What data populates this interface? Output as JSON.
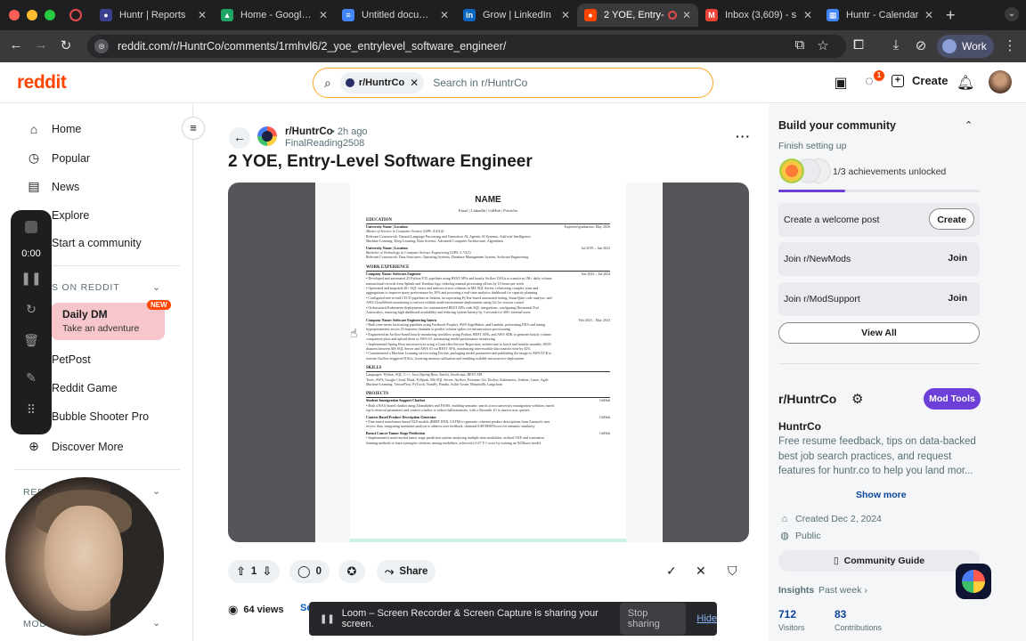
{
  "browser": {
    "tabs": [
      {
        "label": "Huntr | Reports",
        "favicon": "huntr-icon",
        "color": "#3b3f8f"
      },
      {
        "label": "Home - Google Drive",
        "favicon": "google-drive-icon",
        "color": "#1fa463"
      },
      {
        "label": "Untitled document",
        "favicon": "google-docs-icon",
        "color": "#4285f4"
      },
      {
        "label": "Grow | LinkedIn",
        "favicon": "linkedin-icon",
        "color": "#0a66c2"
      },
      {
        "label": "2 YOE, Entry-",
        "favicon": "reddit-icon",
        "color": "#ff4500"
      },
      {
        "label": "Inbox (3,609) - s",
        "favicon": "gmail-icon",
        "color": "#ea4335"
      },
      {
        "label": "Huntr - Calendar",
        "favicon": "calendar-icon",
        "color": "#4285f4"
      }
    ],
    "url": "reddit.com/r/HuntrCo/comments/1rmhvl6/2_yoe_entrylevel_software_engineer/",
    "profile_label": "Work"
  },
  "header": {
    "logo": "reddit",
    "search_chip": "r/HuntrCo",
    "search_placeholder": "Search in r/HuntrCo",
    "chat_badge": "1",
    "create_label": "Create"
  },
  "left_nav": {
    "items": [
      {
        "label": "Home",
        "icon": "home-icon"
      },
      {
        "label": "Popular",
        "icon": "popular-icon"
      },
      {
        "label": "News",
        "icon": "news-icon"
      },
      {
        "label": "Explore",
        "icon": "explore-icon"
      },
      {
        "label": "Start a community",
        "icon": "plus-icon"
      }
    ],
    "section_games": "S ON REDDIT",
    "daily_dm_title": "Daily DM",
    "daily_dm_sub": "Take an adventure",
    "new_badge": "NEW",
    "games": [
      "PetPost",
      "Reddit Game",
      "Bubble Shooter Pro",
      "Discover More"
    ],
    "section_recent": "RED",
    "section_mod": "MOD"
  },
  "loom": {
    "timer": "0:00",
    "share_message": "Loom – Screen Recorder & Screen Capture is sharing your screen.",
    "stop_label": "Stop sharing",
    "hide_label": "Hide"
  },
  "post": {
    "subreddit": "r/HuntrCo",
    "time": "• 2h ago",
    "author": "FinalReading2508",
    "title": "2 YOE, Entry-Level Software Engineer",
    "votes": "1",
    "comments": "0",
    "share_label": "Share",
    "views": "64 views",
    "see_stats": "Se"
  },
  "resume": {
    "name": "NAME",
    "contact": "Email | LinkedIn | GitHub | Portfolio",
    "sections": {
      "education": "EDUCATION",
      "work": "WORK EXPERIENCE",
      "skills": "SKILLS",
      "projects": "PROJECTS"
    },
    "lines": {
      "edu1": "University Name | Location",
      "edu1_date": "Expected graduation: May 2026",
      "edu1_deg": "Master of Science in Computer Science (GPA: 4.0/4.0)",
      "edu1_course": "Relevant Coursework: Natural Language Processing and Generative AI, Agentic AI Systems, Artificial Intelligence,",
      "edu1_course2": "Machine Learning, Deep Learning, Data Science, Advanced Computer Architecture, Algorithms",
      "edu2": "University Name | Location",
      "edu2_date": "Jul 2019 – Jun 2023",
      "edu2_deg": "Bachelor of Technology in Computer Science Engineering (GPA: 3.7/4.0)",
      "edu2_course": "Relevant Coursework: Data Structures, Operating Systems, Database Management System, Software Engineering",
      "job1": "Company Name: Software Engineer",
      "job1_date": "Jun 2023 – Jul 2024",
      "job1_b1": "• Developed and automated 25 Python ETL pipelines using REST APIs and hourly Airflow DAGs to transform 1M+ daily volume",
      "job1_b2": "  transactional records from Splunk and Teradata logs, reducing manual processing efforts by 10 hours per week",
      "job1_b3": "• Optimized and migrated 20+ SQL views and indexes across schemas in MS SQL Server, refactoring complex joins and",
      "job1_b4": "  aggregations to improve query performance by 30% and powering a real-time analytics dashboard for capacity planning",
      "job1_b5": "• Configured end-to-end CI/CD pipelines in Jenkins, incorporating PyTest-based automated testing, SonarQube code analysis, and",
      "job1_b6": "  AWS CloudWatch monitoring to enforce reliable multi-environment deployments using Git for version control",
      "job1_b7": "• Orchestrated Kubernetes deployments for containerized REST APIs with SQL integrations, configuring Horizontal Pod",
      "job1_b8": "  Autoscalers, ensuring high dashboard availability and reducing system latency by 3 seconds for 400+ internal users",
      "job2": "Company Name: Software Engineering Intern",
      "job2_date": "Feb 2023 – May 2023",
      "job2_b1": "• Built time-series forecasting pipelines using Facebook Prophet, AWS SageMaker, and Lambda, performing EDA and tuning",
      "job2_b2": "  hyperparameters across 25 business channels to predict volume spikes for infrastructure provisioning",
      "job2_b3": "• Engineered an Airflow-based hourly monitoring workflow using Python, REST APIs, and AWS SDK to generate hourly volume",
      "job2_b4": "  comparison plots and upload them to AWS S3, automating model performance monitoring",
      "job2_b5": "• Implemented Spring Boot microservices using a Controller-Service-Repository architecture to batch and transfer monthly JSON",
      "job2_b6": "  datasets between MS SQL Server and AWS S3 via REST APIs, minimizing inter-module data transfer time by 42%",
      "job2_b7": "• Containerized a Machine Learning service using Docker, packaging model parameters and publishing the image to AWS ECR to",
      "job2_b8": "  execute Airflow-triggered DAGs, lowering memory utilization and enabling scalable microservice deployment",
      "sk1": "Languages: Python, SQL, C++, Java (Spring Boot, Knife), JavaScript, REST API",
      "sk2": "Tools: AWS, Google Cloud, Flask, PySpark, MS SQL Server, Airflow, Postman, Git, Docker, Kubernetes, Jenkins, Linux, Agile",
      "sk3": "Machine Learning: TensorFlow, PyTorch, NumPy, Pandas, Scikit-Learn, Matplotlib, Langchain",
      "pr1": "Student Immigration Support Chatbot",
      "pr1_b": "• Built a RAG-based chatbot using LlamaIndex and FAISS, enabling semantic search across university immigration websites; tuned",
      "pr1_b2": "  top-k retrieval parameters and context window to reduce hallucinations, with a Streamlit UI to answer user queries",
      "pr2": "Context Based Product Description Generator",
      "pr2_b": "• Fine-tuned transformer-based NLP models (BERT RNN, LSTM) to generate coherent product descriptions from Amazon's user",
      "pr2_b2": "  review data, integrating sentiment analysis to address user feedback, obtained 0.88 BERTScore for semantic similarity",
      "pr3": "Breast Cancer Tumor Stage Prediction",
      "pr3_b": "• Implemented a multi-modal tumor stage prediction system analyzing multiple data modalities, utilized VAE and contrastive",
      "pr3_b2": "  learning methods to learn synergetic relations among modalities, achieved a 0.47 F-1 score by training an XGBoost model.",
      "github": "GitHub"
    }
  },
  "right": {
    "build_title": "Build your community",
    "build_sub": "Finish setting up",
    "achievements": "1/3 achievements unlocked",
    "achievement_progress": 0.33,
    "task1": "Create a welcome post",
    "task1_btn": "Create",
    "task2": "Join r/NewMods",
    "task2_btn": "Join",
    "task3": "Join r/ModSupport",
    "task3_btn": "Join",
    "view_all": "View All",
    "sub_name": "r/HuntrCo",
    "mod_tools": "Mod Tools",
    "display_name": "HuntrCo",
    "description": "Free resume feedback, tips on data-backed best job search practices, and request features for huntr.co to help you land mor...",
    "show_more": "Show more",
    "created": "Created Dec 2, 2024",
    "visibility": "Public",
    "guide": "Community Guide",
    "insights": "Insights",
    "past_week": "Past week",
    "visitors": "712",
    "visitors_label": "Visitors",
    "contributions": "83",
    "contributions_label": "Contributions"
  }
}
